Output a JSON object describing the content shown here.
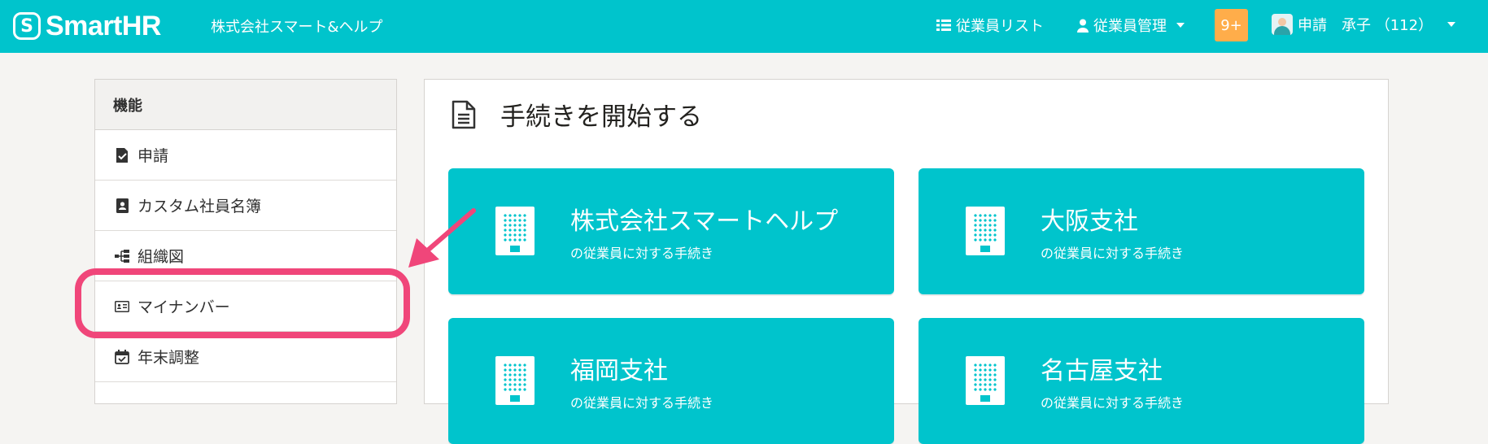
{
  "header": {
    "logo_glyph": "S",
    "logo_text": "SmartHR",
    "company": "株式会社スマート&ヘルプ",
    "nav_employee_list": "従業員リスト",
    "nav_employee_manage": "従業員管理",
    "badge": "9+",
    "user": "申請　承子 （112）",
    "colors": {
      "brand": "#00c4cc",
      "badge": "#ffad4a"
    }
  },
  "sidebar": {
    "heading": "機能",
    "items": [
      {
        "label": "申請",
        "icon": "request-icon"
      },
      {
        "label": "カスタム社員名簿",
        "icon": "address-book-icon"
      },
      {
        "label": "組織図",
        "icon": "org-chart-icon"
      },
      {
        "label": "マイナンバー",
        "icon": "id-card-icon"
      },
      {
        "label": "年末調整",
        "icon": "calendar-check-icon"
      }
    ]
  },
  "main": {
    "title": "手続きを開始する",
    "cards": [
      {
        "name": "株式会社スマートヘルプ",
        "sub": "の従業員に対する手続き"
      },
      {
        "name": "大阪支社",
        "sub": "の従業員に対する手続き"
      },
      {
        "name": "福岡支社",
        "sub": "の従業員に対する手続き"
      },
      {
        "name": "名古屋支社",
        "sub": "の従業員に対する手続き"
      }
    ]
  },
  "annotation": {
    "color": "#f0467a"
  }
}
